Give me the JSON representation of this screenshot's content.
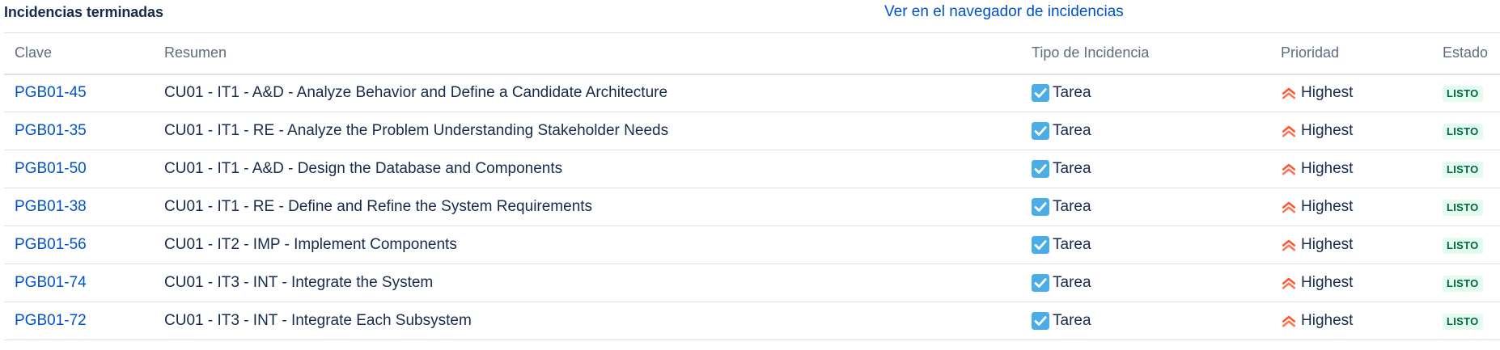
{
  "panel": {
    "title": "Incidencias terminadas",
    "navigator_link": "Ver en el navegador de incidencias"
  },
  "table": {
    "headers": {
      "key": "Clave",
      "summary": "Resumen",
      "type": "Tipo de Incidencia",
      "priority": "Prioridad",
      "status": "Estado"
    },
    "rows": [
      {
        "key": "PGB01-45",
        "summary": "CU01 - IT1 - A&D - Analyze Behavior and Define a Candidate Architecture",
        "type": "Tarea",
        "type_icon": "task-checkbox-icon",
        "priority": "Highest",
        "priority_icon": "priority-highest-icon",
        "status": "LISTO"
      },
      {
        "key": "PGB01-35",
        "summary": "CU01 - IT1 - RE - Analyze the Problem Understanding Stakeholder Needs",
        "type": "Tarea",
        "type_icon": "task-checkbox-icon",
        "priority": "Highest",
        "priority_icon": "priority-highest-icon",
        "status": "LISTO"
      },
      {
        "key": "PGB01-50",
        "summary": "CU01 - IT1 - A&D - Design the Database and Components",
        "type": "Tarea",
        "type_icon": "task-checkbox-icon",
        "priority": "Highest",
        "priority_icon": "priority-highest-icon",
        "status": "LISTO"
      },
      {
        "key": "PGB01-38",
        "summary": "CU01 - IT1 - RE - Define and Refine the System Requirements",
        "type": "Tarea",
        "type_icon": "task-checkbox-icon",
        "priority": "Highest",
        "priority_icon": "priority-highest-icon",
        "status": "LISTO"
      },
      {
        "key": "PGB01-56",
        "summary": "CU01 - IT2 - IMP - Implement Components",
        "type": "Tarea",
        "type_icon": "task-checkbox-icon",
        "priority": "Highest",
        "priority_icon": "priority-highest-icon",
        "status": "LISTO"
      },
      {
        "key": "PGB01-74",
        "summary": "CU01 - IT3 - INT - Integrate the System",
        "type": "Tarea",
        "type_icon": "task-checkbox-icon",
        "priority": "Highest",
        "priority_icon": "priority-highest-icon",
        "status": "LISTO"
      },
      {
        "key": "PGB01-72",
        "summary": "CU01 - IT3 - INT - Integrate Each Subsystem",
        "type": "Tarea",
        "type_icon": "task-checkbox-icon",
        "priority": "Highest",
        "priority_icon": "priority-highest-icon",
        "status": "LISTO"
      }
    ]
  },
  "colors": {
    "link": "#0052cc",
    "text": "#172b4d",
    "header_text": "#5e6c84",
    "task_icon": "#4bade8",
    "priority_highest": "#ff5630",
    "status_done_bg": "#e3fcef",
    "status_done_text": "#006644",
    "divider": "#dfe1e6"
  }
}
